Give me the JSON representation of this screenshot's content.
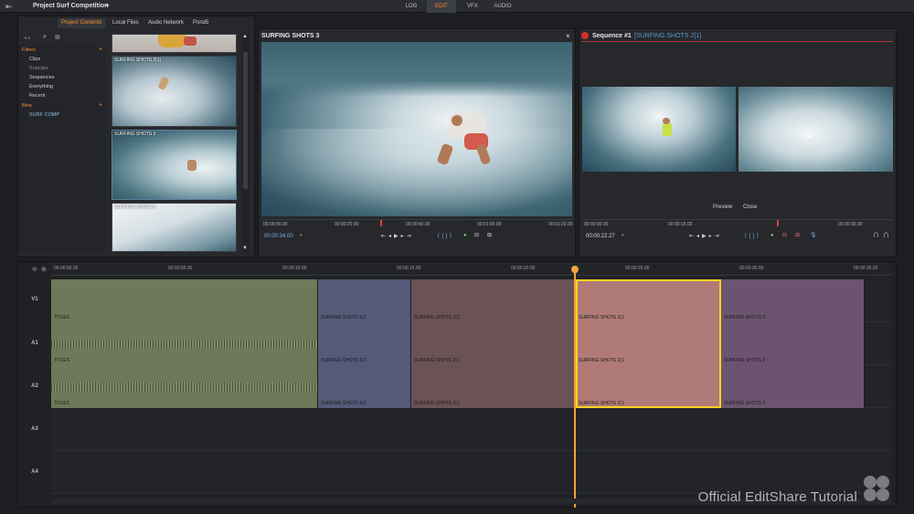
{
  "app": {
    "project_title": "Project Surf Competition",
    "modes": [
      "LOG",
      "EDIT",
      "VFX",
      "AUDIO"
    ],
    "active_mode": "EDIT",
    "accent": "#ff8a2a"
  },
  "browser": {
    "tabs": [
      "Project Contents",
      "Local Files",
      "Audio Network",
      "Pond5"
    ],
    "filters_header": "Filters",
    "filters": [
      "Clips",
      "Subclips",
      "Sequences",
      "Everything",
      "Recent"
    ],
    "bins_header": "Bins",
    "bins": [
      "SURF COMP"
    ],
    "thumbnails": [
      "SURFING SHOTS 2(1)",
      "SURFING SHOTS 3",
      "SURFING SHOTS 4"
    ]
  },
  "source_viewer": {
    "title": "SURFING SHOTS 3",
    "timecodes": [
      "00:00:00.00",
      "00:00:20.00",
      "00:00:40.00",
      "00:01:00.00",
      "00:01:20.00"
    ],
    "current_tc": "00:00:34.00"
  },
  "record_viewer": {
    "title": "Sequence #1",
    "subtitle": "[SURFING SHOTS 2[1]",
    "preview_label": "Preview",
    "close_label": "Close",
    "timecodes": [
      "00:00:00.00",
      "00:00:15.00",
      "00:00:30.00"
    ],
    "current_tc": "00:00:22.27"
  },
  "timeline": {
    "ruler": [
      "00:00:00.00",
      "00:00:05.00",
      "00:00:10.00",
      "00:00:15.00",
      "00:00:20.00",
      "00:00:25.00",
      "00:00:30.00",
      "00:00:35.00"
    ],
    "tracks": [
      "V1",
      "A1",
      "A2",
      "A3",
      "A4"
    ],
    "clips": [
      {
        "label": "TITLES",
        "color": "#717a5c"
      },
      {
        "label": "SURFING SHOTS 5(1",
        "color": "#545a78"
      },
      {
        "label": "SURFING SHOTS 2(1",
        "color": "#6c5357"
      },
      {
        "label": "SURFING SHOTS 2(1",
        "color": "#b27c78"
      },
      {
        "label": "SURFING SHOTS 3",
        "color": "#6e5570"
      }
    ],
    "a1_clips": [
      "TITLES",
      "SURFING SHOTS 5(1",
      "SURFING SHOTS 2(1",
      "SURFING SHOTS 2(1",
      "SURFING SHOTS 3"
    ],
    "a2_clips": [
      "TITLES",
      "SURFING SHOTS 5(1",
      "SURFING SHOTS 2(1",
      "SURFING SHOTS 2(1",
      "SURFING SHOTS 3"
    ]
  },
  "watermark": "Official EditShare Tutorial"
}
